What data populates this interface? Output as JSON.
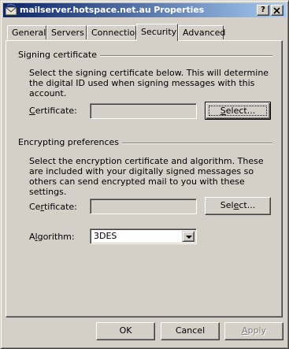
{
  "window": {
    "title": "mailserver.hotspace.net.au Properties",
    "help_button": "?",
    "close_button": "x"
  },
  "tabs": [
    {
      "label": "General"
    },
    {
      "label": "Servers"
    },
    {
      "label": "Connection"
    },
    {
      "label": "Security",
      "active": true
    },
    {
      "label": "Advanced"
    }
  ],
  "signing": {
    "heading": "Signing certificate",
    "description": "Select the signing certificate below. This will determine the digital ID used when signing messages with this account.",
    "certificate_label_accel": "C",
    "certificate_label_rest": "ertificate:",
    "certificate_value": "",
    "select_button_accel": "S",
    "select_button_rest": "elect..."
  },
  "encrypting": {
    "heading": "Encrypting preferences",
    "description": "Select the encryption certificate and algorithm. These are included with your digitally signed messages so others can send encrypted mail to you with these settings.",
    "certificate_label_pre": "Ce",
    "certificate_label_accel": "r",
    "certificate_label_rest": "tificate:",
    "certificate_value": "",
    "select_button_pre": "Sel",
    "select_button_accel": "e",
    "select_button_rest": "ct...",
    "algorithm_label_pre": "A",
    "algorithm_label_accel": "l",
    "algorithm_label_rest": "gorithm:",
    "algorithm_value": "3DES"
  },
  "footer": {
    "ok": "OK",
    "cancel": "Cancel",
    "apply_accel": "A",
    "apply_rest": "pply"
  },
  "colors": {
    "titlebar_start": "#0a246a",
    "titlebar_end": "#a6caf0",
    "face": "#d4d0c8"
  }
}
